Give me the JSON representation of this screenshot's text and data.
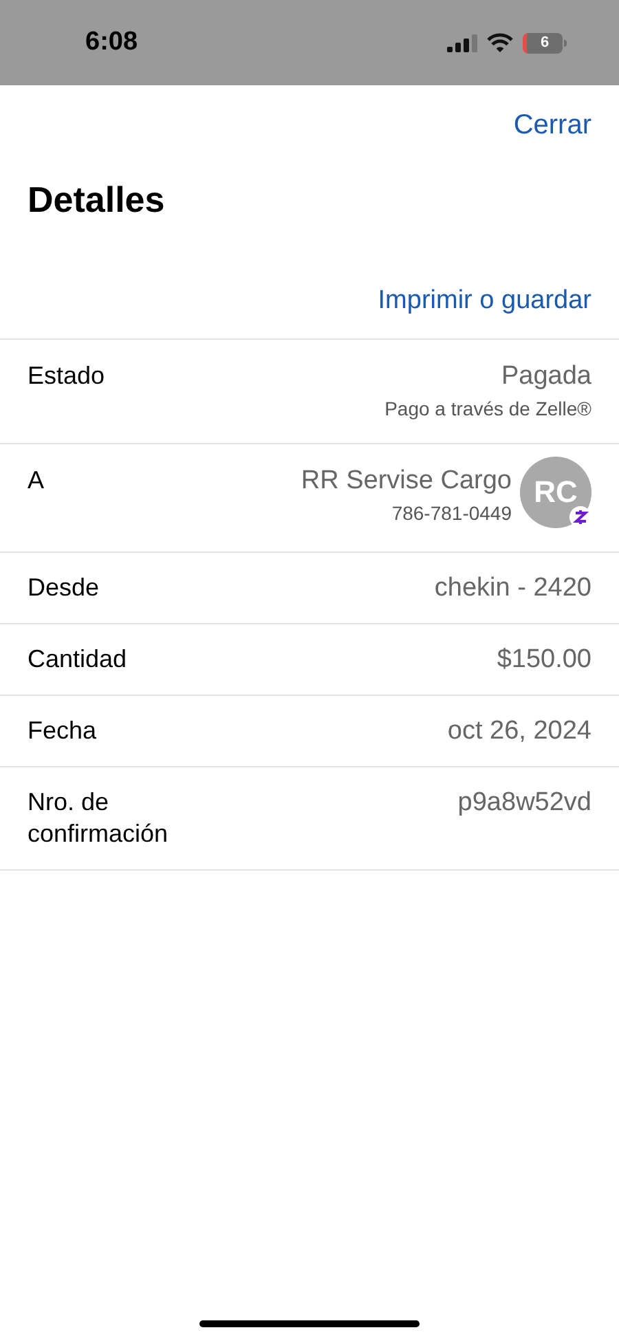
{
  "status_bar": {
    "time": "6:08",
    "battery": "6"
  },
  "close": "Cerrar",
  "title": "Detalles",
  "print": "Imprimir o guardar",
  "rows": [
    {
      "kind": "status",
      "label": "Estado",
      "value": "Pagada",
      "note": "Pago a través de Zelle®"
    },
    {
      "kind": "contact",
      "label": "A",
      "value": "RR Servise Cargo",
      "note": "786-781-0449",
      "initials": "RC"
    },
    {
      "kind": "plain",
      "label": "Desde",
      "value": "chekin - 2420"
    },
    {
      "kind": "plain",
      "label": "Cantidad",
      "value": "$150.00"
    },
    {
      "kind": "plain",
      "label": "Fecha",
      "value": "oct 26, 2024"
    },
    {
      "kind": "plain",
      "label": "Nro. de confirmación",
      "value": "p9a8w52vd"
    }
  ]
}
